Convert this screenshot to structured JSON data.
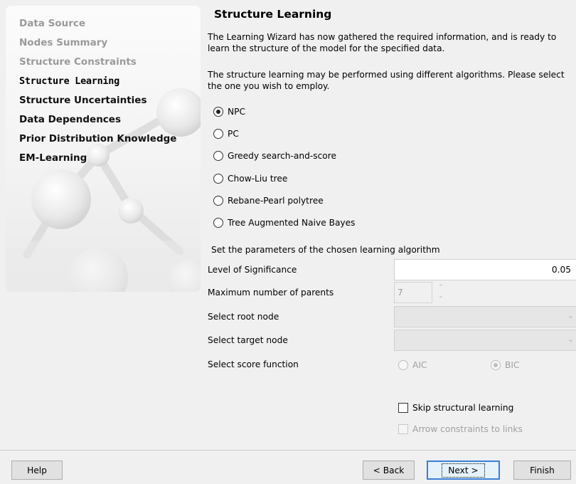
{
  "sidebar": {
    "steps": [
      {
        "label": "Data Source",
        "state": "done"
      },
      {
        "label": "Nodes Summary",
        "state": "done"
      },
      {
        "label": "Structure Constraints",
        "state": "done"
      },
      {
        "label": "Structure Learning",
        "state": "current"
      },
      {
        "label": "Structure Uncertainties",
        "state": "todo"
      },
      {
        "label": "Data Dependences",
        "state": "todo"
      },
      {
        "label": "Prior Distribution Knowledge",
        "state": "todo"
      },
      {
        "label": "EM-Learning",
        "state": "todo"
      }
    ]
  },
  "main": {
    "title": "Structure Learning",
    "intro": "The Learning Wizard has now gathered the required information, and is ready to learn the structure of the model for the specified data.",
    "algorithm_prompt": "The structure learning may be performed using different algorithms. Please select the one you wish to employ.",
    "algorithms": [
      {
        "label": "NPC",
        "selected": true
      },
      {
        "label": "PC",
        "selected": false
      },
      {
        "label": "Greedy search-and-score",
        "selected": false
      },
      {
        "label": "Chow-Liu tree",
        "selected": false
      },
      {
        "label": "Rebane-Pearl polytree",
        "selected": false
      },
      {
        "label": "Tree Augmented Naive Bayes",
        "selected": false
      }
    ],
    "params_heading": "Set the parameters of the chosen learning algorithm",
    "params": {
      "significance_label": "Level of Significance",
      "significance_value": "0.05",
      "max_parents_label": "Maximum number of parents",
      "max_parents_value": "7",
      "root_node_label": "Select root node",
      "target_node_label": "Select target node",
      "score_function_label": "Select score function",
      "score_options": [
        {
          "label": "AIC",
          "selected": false,
          "enabled": false
        },
        {
          "label": "BIC",
          "selected": true,
          "enabled": false
        }
      ]
    },
    "skip_structural_label": "Skip structural learning",
    "skip_structural_checked": false,
    "arrow_constraints_label": "Arrow constraints to links",
    "arrow_constraints_enabled": false
  },
  "buttons": {
    "help": "Help",
    "back": "< Back",
    "next": "Next >",
    "finish": "Finish"
  },
  "colors": {
    "current_step_highlight": "#cfe3f6",
    "default_button_border": "#3b7fd6"
  }
}
